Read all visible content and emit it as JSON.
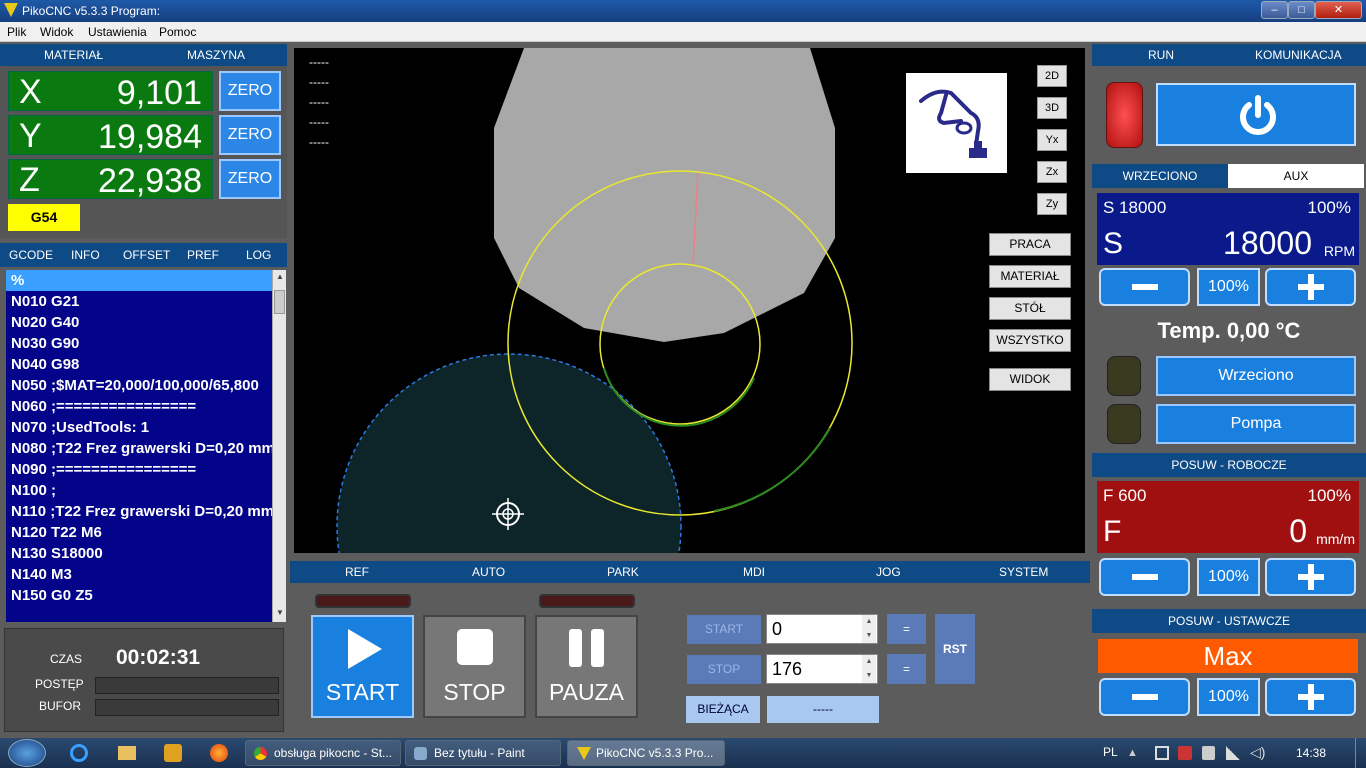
{
  "window": {
    "title": "PikoCNC v5.3.3    Program:",
    "min": "–",
    "max": "□",
    "close": "✕"
  },
  "menu": [
    "Plik",
    "Widok",
    "Ustawienia",
    "Pomoc"
  ],
  "coords": {
    "tabs": [
      "MATERIAŁ",
      "MASZYNA"
    ],
    "axes": [
      {
        "label": "X",
        "value": "9,101"
      },
      {
        "label": "Y",
        "value": "19,984"
      },
      {
        "label": "Z",
        "value": "22,938"
      }
    ],
    "zero_label": "ZERO",
    "wcs": "G54"
  },
  "tabs": [
    "GCODE",
    "INFO",
    "OFFSET",
    "PREF",
    "LOG"
  ],
  "gcode": [
    "%",
    "N010 G21",
    "N020 G40",
    "N030 G90",
    "N040 G98",
    "N050 ;$MAT=20,000/100,000/65,800",
    "N060 ;================",
    "N070 ;UsedTools: 1",
    "N080 ;T22 Frez grawerski D=0,20 mm",
    "N090 ;================",
    "N100 ;",
    "N110 ;T22 Frez grawerski D=0,20 mm",
    "N120 T22 M6",
    "N130 S18000",
    "N140 M3",
    "N150 G0 Z5"
  ],
  "status": {
    "time_label": "CZAS",
    "time": "00:02:31",
    "progress_label": "POSTĘP",
    "buffer_label": "BUFOR"
  },
  "view": {
    "dashes": [
      "-----",
      "-----",
      "-----",
      "-----",
      "-----"
    ],
    "buttons": [
      "2D",
      "3D",
      "Yx",
      "Zx",
      "Zy"
    ],
    "work": [
      "PRACA",
      "MATERIAŁ",
      "STÓŁ",
      "WSZYSTKO"
    ],
    "widok": "WIDOK"
  },
  "modes": [
    "REF",
    "AUTO",
    "PARK",
    "MDI",
    "JOG",
    "SYSTEM"
  ],
  "run": {
    "start": "START",
    "stop": "STOP",
    "pause": "PAUZA",
    "start_label": "START",
    "stop_label": "STOP",
    "start_val": "0",
    "stop_val": "176",
    "eq": "=",
    "rst": "RST",
    "current": "BIEŻĄCA",
    "current_val": "-----"
  },
  "right": {
    "tabs": [
      "RUN",
      "KOMUNIKACJA"
    ]
  },
  "spindle": {
    "tabs": [
      "WRZECIONO",
      "AUX"
    ],
    "s_set": "S 18000",
    "s_pct": "100%",
    "s_label": "S",
    "s_val": "18000",
    "unit": "RPM",
    "pct_btn": "100%",
    "temp": "Temp. 0,00 °C",
    "spindle_btn": "Wrzeciono",
    "pump_btn": "Pompa"
  },
  "feed": {
    "title": "POSUW - ROBOCZE",
    "f_set": "F 600",
    "f_pct": "100%",
    "f_label": "F",
    "f_val": "0",
    "unit": "mm/m",
    "pct_btn": "100%"
  },
  "rapid": {
    "title": "POSUW - USTAWCZE",
    "val": "Max",
    "pct_btn": "100%"
  },
  "taskbar": {
    "items": [
      "obsługa pikocnc - St...",
      "Bez tytułu - Paint",
      "PikoCNC v5.3.3    Pro..."
    ],
    "lang": "PL",
    "clock": "14:38"
  },
  "colors": {
    "accent": "#1a80e0",
    "header": "#0e4a86",
    "axis_bg": "#0a7a10",
    "feed_bg": "#a01010",
    "rapid_bg": "#ff5a00"
  }
}
